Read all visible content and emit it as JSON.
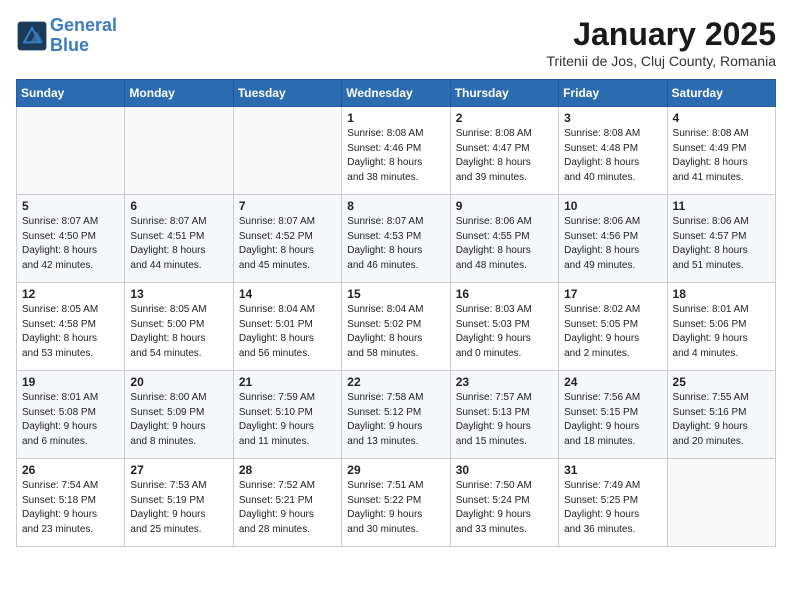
{
  "header": {
    "logo_line1": "General",
    "logo_line2": "Blue",
    "month": "January 2025",
    "location": "Tritenii de Jos, Cluj County, Romania"
  },
  "weekdays": [
    "Sunday",
    "Monday",
    "Tuesday",
    "Wednesday",
    "Thursday",
    "Friday",
    "Saturday"
  ],
  "weeks": [
    [
      {
        "day": "",
        "info": ""
      },
      {
        "day": "",
        "info": ""
      },
      {
        "day": "",
        "info": ""
      },
      {
        "day": "1",
        "info": "Sunrise: 8:08 AM\nSunset: 4:46 PM\nDaylight: 8 hours\nand 38 minutes."
      },
      {
        "day": "2",
        "info": "Sunrise: 8:08 AM\nSunset: 4:47 PM\nDaylight: 8 hours\nand 39 minutes."
      },
      {
        "day": "3",
        "info": "Sunrise: 8:08 AM\nSunset: 4:48 PM\nDaylight: 8 hours\nand 40 minutes."
      },
      {
        "day": "4",
        "info": "Sunrise: 8:08 AM\nSunset: 4:49 PM\nDaylight: 8 hours\nand 41 minutes."
      }
    ],
    [
      {
        "day": "5",
        "info": "Sunrise: 8:07 AM\nSunset: 4:50 PM\nDaylight: 8 hours\nand 42 minutes."
      },
      {
        "day": "6",
        "info": "Sunrise: 8:07 AM\nSunset: 4:51 PM\nDaylight: 8 hours\nand 44 minutes."
      },
      {
        "day": "7",
        "info": "Sunrise: 8:07 AM\nSunset: 4:52 PM\nDaylight: 8 hours\nand 45 minutes."
      },
      {
        "day": "8",
        "info": "Sunrise: 8:07 AM\nSunset: 4:53 PM\nDaylight: 8 hours\nand 46 minutes."
      },
      {
        "day": "9",
        "info": "Sunrise: 8:06 AM\nSunset: 4:55 PM\nDaylight: 8 hours\nand 48 minutes."
      },
      {
        "day": "10",
        "info": "Sunrise: 8:06 AM\nSunset: 4:56 PM\nDaylight: 8 hours\nand 49 minutes."
      },
      {
        "day": "11",
        "info": "Sunrise: 8:06 AM\nSunset: 4:57 PM\nDaylight: 8 hours\nand 51 minutes."
      }
    ],
    [
      {
        "day": "12",
        "info": "Sunrise: 8:05 AM\nSunset: 4:58 PM\nDaylight: 8 hours\nand 53 minutes."
      },
      {
        "day": "13",
        "info": "Sunrise: 8:05 AM\nSunset: 5:00 PM\nDaylight: 8 hours\nand 54 minutes."
      },
      {
        "day": "14",
        "info": "Sunrise: 8:04 AM\nSunset: 5:01 PM\nDaylight: 8 hours\nand 56 minutes."
      },
      {
        "day": "15",
        "info": "Sunrise: 8:04 AM\nSunset: 5:02 PM\nDaylight: 8 hours\nand 58 minutes."
      },
      {
        "day": "16",
        "info": "Sunrise: 8:03 AM\nSunset: 5:03 PM\nDaylight: 9 hours\nand 0 minutes."
      },
      {
        "day": "17",
        "info": "Sunrise: 8:02 AM\nSunset: 5:05 PM\nDaylight: 9 hours\nand 2 minutes."
      },
      {
        "day": "18",
        "info": "Sunrise: 8:01 AM\nSunset: 5:06 PM\nDaylight: 9 hours\nand 4 minutes."
      }
    ],
    [
      {
        "day": "19",
        "info": "Sunrise: 8:01 AM\nSunset: 5:08 PM\nDaylight: 9 hours\nand 6 minutes."
      },
      {
        "day": "20",
        "info": "Sunrise: 8:00 AM\nSunset: 5:09 PM\nDaylight: 9 hours\nand 8 minutes."
      },
      {
        "day": "21",
        "info": "Sunrise: 7:59 AM\nSunset: 5:10 PM\nDaylight: 9 hours\nand 11 minutes."
      },
      {
        "day": "22",
        "info": "Sunrise: 7:58 AM\nSunset: 5:12 PM\nDaylight: 9 hours\nand 13 minutes."
      },
      {
        "day": "23",
        "info": "Sunrise: 7:57 AM\nSunset: 5:13 PM\nDaylight: 9 hours\nand 15 minutes."
      },
      {
        "day": "24",
        "info": "Sunrise: 7:56 AM\nSunset: 5:15 PM\nDaylight: 9 hours\nand 18 minutes."
      },
      {
        "day": "25",
        "info": "Sunrise: 7:55 AM\nSunset: 5:16 PM\nDaylight: 9 hours\nand 20 minutes."
      }
    ],
    [
      {
        "day": "26",
        "info": "Sunrise: 7:54 AM\nSunset: 5:18 PM\nDaylight: 9 hours\nand 23 minutes."
      },
      {
        "day": "27",
        "info": "Sunrise: 7:53 AM\nSunset: 5:19 PM\nDaylight: 9 hours\nand 25 minutes."
      },
      {
        "day": "28",
        "info": "Sunrise: 7:52 AM\nSunset: 5:21 PM\nDaylight: 9 hours\nand 28 minutes."
      },
      {
        "day": "29",
        "info": "Sunrise: 7:51 AM\nSunset: 5:22 PM\nDaylight: 9 hours\nand 30 minutes."
      },
      {
        "day": "30",
        "info": "Sunrise: 7:50 AM\nSunset: 5:24 PM\nDaylight: 9 hours\nand 33 minutes."
      },
      {
        "day": "31",
        "info": "Sunrise: 7:49 AM\nSunset: 5:25 PM\nDaylight: 9 hours\nand 36 minutes."
      },
      {
        "day": "",
        "info": ""
      }
    ]
  ]
}
